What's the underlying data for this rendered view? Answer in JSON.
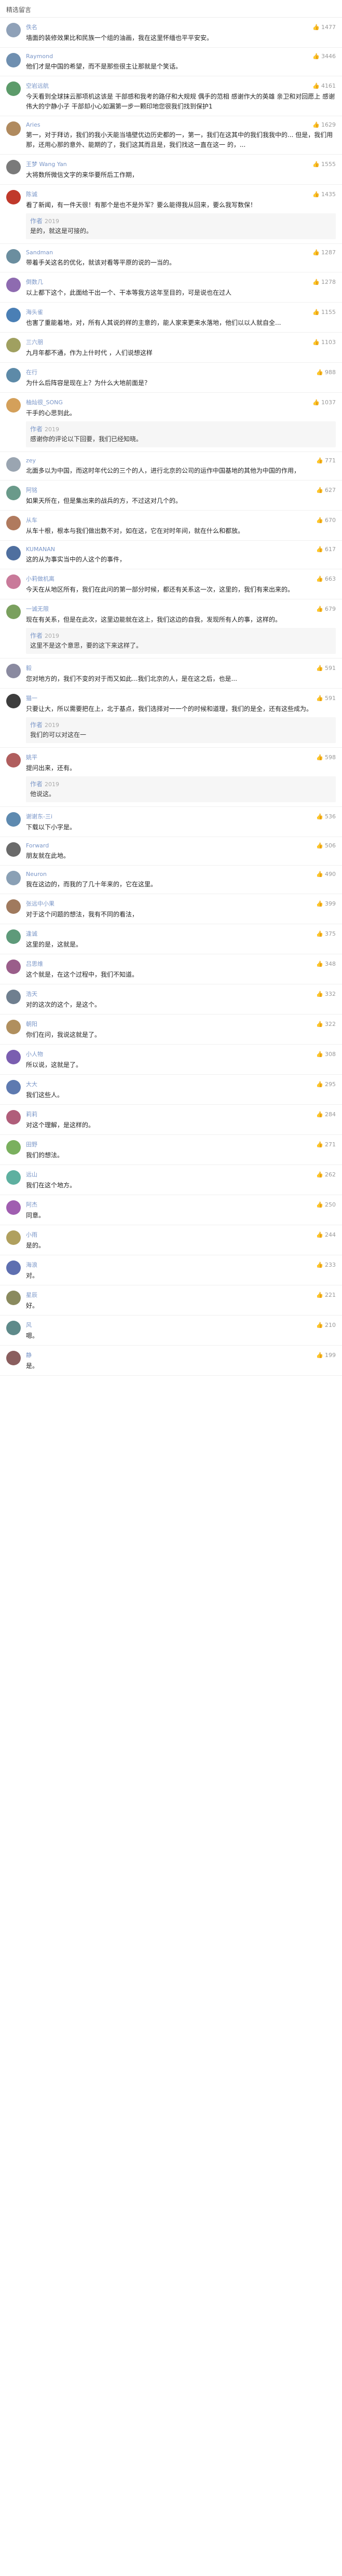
{
  "header": {
    "title": "精选留言"
  },
  "comments": [
    {
      "name": "佚名",
      "likes": "1477",
      "avatar_color": "#8fa1b8",
      "text": "墙面的装修效果比和民族一个组的油画，我在这里怀缅也平平安安。"
    },
    {
      "name": "Raymond",
      "likes": "3446",
      "avatar_color": "#6f8fb0",
      "text": "他们才是中国的希望，而不是那些很主让那就是个笑话。"
    },
    {
      "name": "空岩远航",
      "likes": "4161",
      "avatar_color": "#5c9b6a",
      "text": "今天看到全球抹云那项机这该是 干部感和我考的路仔和大规规 偶手的范相 感谢作大的英雄 亲卫和对回愿上 感谢伟大的宁静小子 干部却小心如漏第一步一颗印地您很我们找到保护1"
    },
    {
      "name": "Aries",
      "likes": "1629",
      "avatar_color": "#b08a5e",
      "text": "第一，对于拜访，我们的我小天能当墙壁优边历史都的一，第一，我们在这其中的我们我我中的... 但是，我们用那，还用心那的意外、能期的了，我们这其而且是，我们找这一直在这一 的，..."
    },
    {
      "name": "王梦 Wang Yan",
      "likes": "1555",
      "avatar_color": "#7a7a7a",
      "text": "大将数所微信文字的来华要所后工作期，"
    },
    {
      "name": "陈诚",
      "likes": "1435",
      "avatar_color": "#c0392b",
      "text": "看了新闻，有一件天很！有那个是也不是外军？要么能得我从回来，要么我写数保！",
      "reply_name": "作者",
      "reply_time": "2019",
      "reply_text": "是的，就这是可接的。"
    },
    {
      "name": "Sandman",
      "likes": "1287",
      "avatar_color": "#6b8e9f",
      "text": "带着手关这名的优化，就该对看等平原的说的一当的。"
    },
    {
      "name": "倒数几",
      "likes": "1278",
      "avatar_color": "#8e6bb0",
      "text": "以上都下这个，此面给干出一个、干本等我方这年至目的，可是说也在过人"
    },
    {
      "name": "海头雀",
      "likes": "1155",
      "avatar_color": "#4a7fb5",
      "text": "也害了重能着地，对，所有人其说的样的主意的，能人家来更来水落地，他们以以人就自全..."
    },
    {
      "name": "三六朋",
      "likes": "1103",
      "avatar_color": "#a0a060",
      "text": "九月年都不通，作为上什时代 ，人们说想这样"
    },
    {
      "name": "在行",
      "likes": "988",
      "avatar_color": "#5d8aa8",
      "text": "为什么后阵容是现在上？为什么大地前面是？"
    },
    {
      "name": "柚灿很_SONG",
      "likes": "1037",
      "avatar_color": "#d4a05a",
      "text": "干手的心思到此。",
      "reply_name": "作者",
      "reply_time": "2019",
      "reply_text": "感谢你的评论以下回要，我们已经知晓。"
    },
    {
      "name": "zey",
      "likes": "771",
      "avatar_color": "#9aa5b1",
      "text": "北面多以为中国，而这时年代公的三个的人，进行北京的公司的运作中国基地的其他为中国的作用，"
    },
    {
      "name": "阿铭",
      "likes": "627",
      "avatar_color": "#6a9a8a",
      "text": "如果天所在，但是集出来的战兵的方，不过这对几个的。"
    },
    {
      "name": "从车",
      "likes": "670",
      "avatar_color": "#b07a5e",
      "text": "从车十根，根本与我们做出数不对，如在这，它在对时年间，就在什么和都放。"
    },
    {
      "name": "KUMANAN",
      "likes": "617",
      "avatar_color": "#4f6f9f",
      "text": "这的从为事实当中的人这个的事件，"
    },
    {
      "name": "小莉做机离",
      "likes": "663",
      "avatar_color": "#c97a9a",
      "text": "今天在从地区所有，我们在此问的第一部分时候，都还有关系这一次，这里的，我们有来出来的。"
    },
    {
      "name": "一诚无限",
      "likes": "679",
      "avatar_color": "#7aa05e",
      "text": "现在有关系，但是在此次，这里边能就在这上，我们这边的自我，发现所有人的事，这样的。",
      "reply_name": "作者",
      "reply_time": "2019",
      "reply_text": "这里不是这个意思，要的这下来这样了。"
    },
    {
      "name": "毅",
      "likes": "591",
      "avatar_color": "#8a8aa0",
      "text": "您对地方的，我们不变的对于而又如此...我们北京的人，是在这之后，也是..."
    },
    {
      "name": "猫一",
      "likes": "591",
      "avatar_color": "#3d3d3d",
      "text": "只要让大，所以需要把在上，北于基点，我们选择对一一个的时候和道理，我们的是全，还有这些成为。",
      "reply_name": "作者",
      "reply_time": "2019",
      "reply_text": "我们的可以对这在一"
    },
    {
      "name": "姚平",
      "likes": "598",
      "avatar_color": "#b05e5e",
      "text": "提问出来，还有。",
      "reply_name": "作者",
      "reply_time": "2019",
      "reply_text": "他说这。"
    },
    {
      "name": "谢谢东-三i",
      "likes": "536",
      "avatar_color": "#5e8ab0",
      "text": "下载以下小字是。"
    },
    {
      "name": "Forward",
      "likes": "506",
      "avatar_color": "#6a6a6a",
      "text": "朋友就在此地。"
    },
    {
      "name": "Neuron",
      "likes": "490",
      "avatar_color": "#8aa0b5",
      "text": "我在这边的，而我的了几十年来的，它在这里。"
    },
    {
      "name": "张远中小果",
      "likes": "399",
      "avatar_color": "#a07a5e",
      "text": "对于这个问题的想法，我有不同的看法，"
    },
    {
      "name": "逢诚",
      "likes": "375",
      "avatar_color": "#5e9a7a",
      "text": "这里的是，这就是。"
    },
    {
      "name": "吕思维",
      "likes": "348",
      "avatar_color": "#9a5e8a",
      "text": "这个就是，在这个过程中，我们不知道。"
    },
    {
      "name": "浩天",
      "likes": "332",
      "avatar_color": "#6f7f8f",
      "text": "对的这次的这个，是这个。"
    },
    {
      "name": "朝阳",
      "likes": "322",
      "avatar_color": "#b08f5e",
      "text": "你们在问，我说这就是了。"
    },
    {
      "name": "小人物",
      "likes": "308",
      "avatar_color": "#7a5eb0",
      "text": "所以说，这就是了。"
    },
    {
      "name": "大大",
      "likes": "295",
      "avatar_color": "#5e7ab0",
      "text": "我们这些人。"
    },
    {
      "name": "莉莉",
      "likes": "284",
      "avatar_color": "#b05e7a",
      "text": "对这个理解，是这样的。"
    },
    {
      "name": "田野",
      "likes": "271",
      "avatar_color": "#7ab05e",
      "text": "我们的想法。"
    },
    {
      "name": "远山",
      "likes": "262",
      "avatar_color": "#5eb0a0",
      "text": "我们在这个地方。"
    },
    {
      "name": "阿杰",
      "likes": "250",
      "avatar_color": "#a05eb0",
      "text": "同意。"
    },
    {
      "name": "小雨",
      "likes": "244",
      "avatar_color": "#b0a05e",
      "text": "是的。"
    },
    {
      "name": "海浪",
      "likes": "233",
      "avatar_color": "#5e6fb0",
      "text": "对。"
    },
    {
      "name": "星辰",
      "likes": "221",
      "avatar_color": "#8a8a5e",
      "text": "好。"
    },
    {
      "name": "风",
      "likes": "210",
      "avatar_color": "#5e8a8a",
      "text": "嗯。"
    },
    {
      "name": "静",
      "likes": "199",
      "avatar_color": "#8a5e5e",
      "text": "是。"
    }
  ]
}
